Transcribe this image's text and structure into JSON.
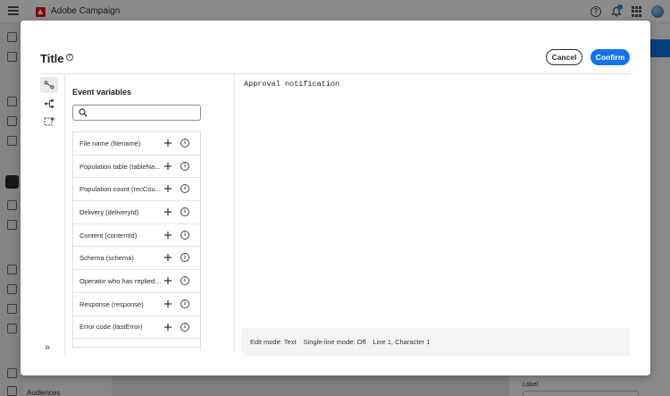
{
  "app": {
    "name": "Adobe Campaign",
    "rail_label": "Audiences",
    "field_label": "Label"
  },
  "dialog": {
    "title": "Title",
    "cancel_label": "Cancel",
    "confirm_label": "Confirm"
  },
  "variables_panel": {
    "heading": "Event variables",
    "search_value": "",
    "items": [
      {
        "label": "File name (filename)"
      },
      {
        "label": "Population table (tableNa..."
      },
      {
        "label": "Population count (recCou..."
      },
      {
        "label": "Delivery (deliveryId)"
      },
      {
        "label": "Content (contentId)"
      },
      {
        "label": "Schema (schema)"
      },
      {
        "label": "Operator who has replied ..."
      },
      {
        "label": "Response (response)"
      },
      {
        "label": "Error code (lastError)"
      }
    ]
  },
  "editor": {
    "content": "Approval notification"
  },
  "status": {
    "edit_mode": "Edit mode: Text",
    "single_line": "Single-line mode: Off",
    "position": "Line 1, Character 1"
  },
  "colors": {
    "accent": "#1473e6",
    "brand": "#eb1000"
  }
}
